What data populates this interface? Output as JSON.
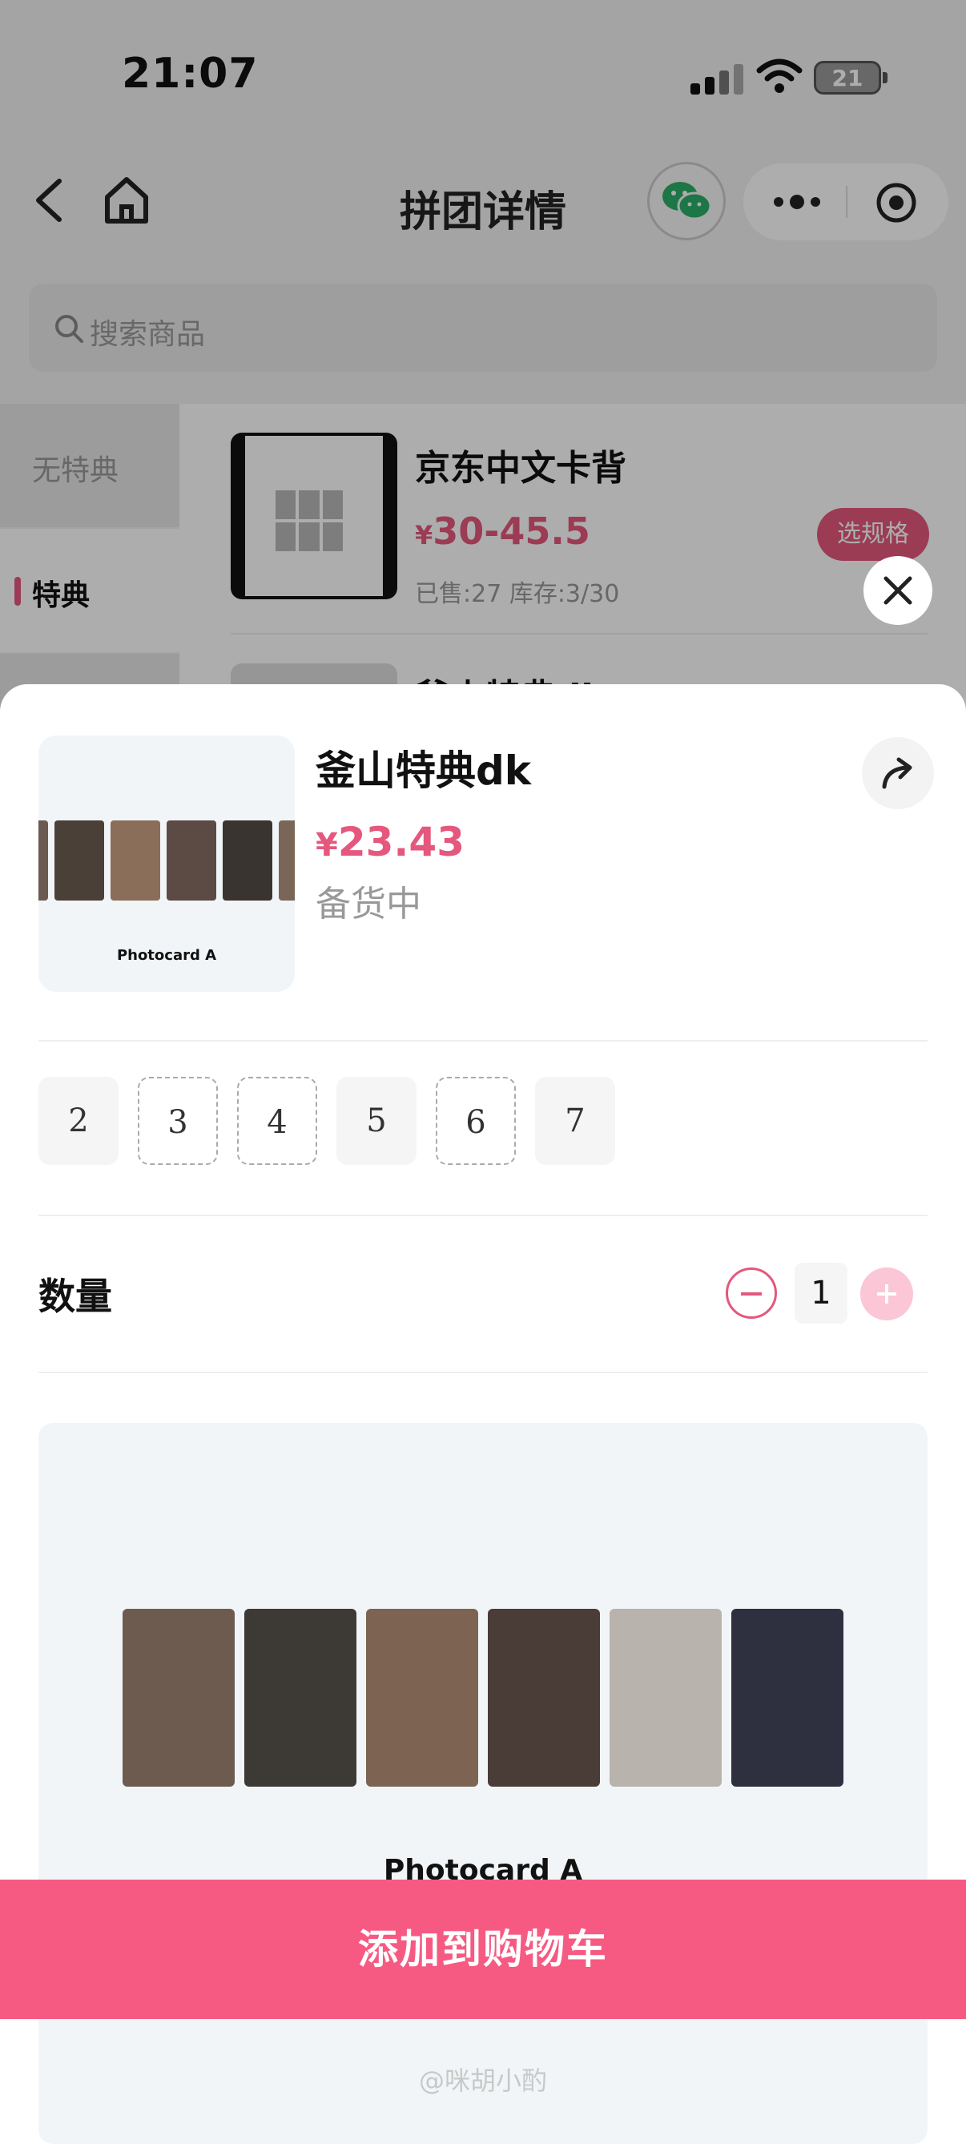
{
  "status_bar": {
    "time": "21:07",
    "battery": "21"
  },
  "nav": {
    "title": "拼团详情"
  },
  "search": {
    "placeholder": "搜索商品"
  },
  "categories": [
    {
      "label": "无特典"
    },
    {
      "label": "特典"
    }
  ],
  "product_list": [
    {
      "title": "京东中文卡背",
      "price_symbol": "¥",
      "price": "30-45.5",
      "meta": "已售:27 库存:3/30",
      "button": "选规格"
    },
    {
      "title": "釜山特典dk"
    }
  ],
  "sheet": {
    "title": "釜山特典dk",
    "price_symbol": "¥",
    "price": "23.43",
    "status": "备货中",
    "image_label": "Photocard A",
    "options": [
      "2",
      "3",
      "4",
      "5",
      "6",
      "7"
    ],
    "quantity_label": "数量",
    "quantity": "1",
    "detail_image_label": "Photocard A",
    "add_to_cart": "添加到购物车"
  },
  "watermark": "@咪胡小酌",
  "colors": {
    "accent": "#e5577d",
    "button": "#f65a82",
    "plus_disabled": "#fbc6d6"
  }
}
